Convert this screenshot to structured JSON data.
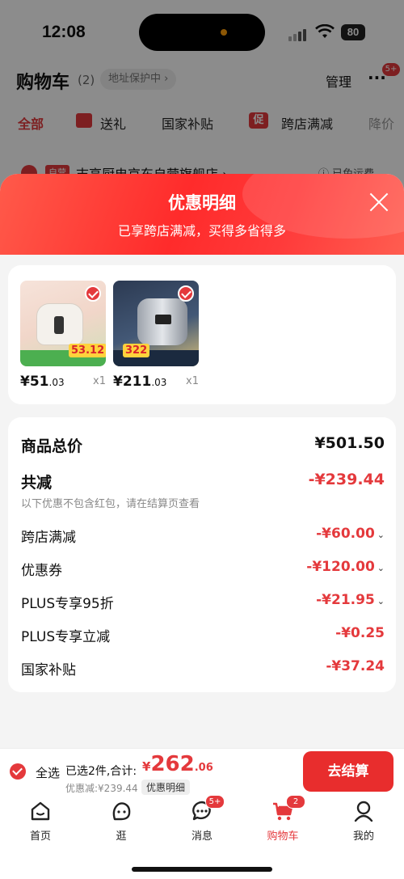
{
  "status_bar": {
    "time": "12:08",
    "battery": "80"
  },
  "background_cart": {
    "title": "购物车",
    "count": "(2)",
    "address_protection": "地址保护中 ›",
    "manage": "管理",
    "more_badge": "5+",
    "tabs": [
      "全部",
      "送礼",
      "国家补贴",
      "跨店满减",
      "降价"
    ],
    "cu_icon": "促",
    "store_tag": "自营",
    "store_name": "志高厨电京东自营旗舰店 ›",
    "shipping": "ⓘ 已免运费"
  },
  "sheet": {
    "title": "优惠明细",
    "subtitle": "已享跨店满减，买得多省得多",
    "products": [
      {
        "price_int": "¥51",
        "price_dec": ".03",
        "qty": "x1",
        "promo_price": "53.12"
      },
      {
        "price_int": "¥211",
        "price_dec": ".03",
        "qty": "x1",
        "promo_price": "322"
      }
    ],
    "summary": {
      "total_label": "商品总价",
      "total_value": "¥501.50",
      "reduce_label": "共减",
      "reduce_value": "-¥239.44",
      "note": "以下优惠不包含红包，请在结算页查看",
      "rows": [
        {
          "label": "跨店满减",
          "value": "-¥60.00",
          "chevron": "⌄"
        },
        {
          "label": "优惠券",
          "value": "-¥120.00",
          "chevron": "⌄"
        },
        {
          "label": "PLUS专享95折",
          "value": "-¥21.95",
          "chevron": "⌄"
        },
        {
          "label": "PLUS专享立减",
          "value": "-¥0.25",
          "chevron": ""
        },
        {
          "label": "国家补贴",
          "value": "-¥37.24",
          "chevron": ""
        }
      ]
    }
  },
  "bottom_bar": {
    "select_all": "全选",
    "selected_text": "已选2件,合计:",
    "total_yen": "¥",
    "total_int": "262",
    "total_dec": ".06",
    "discount_text": "优惠减:¥239.44",
    "discount_button": "优惠明细",
    "checkout": "去结算"
  },
  "nav": {
    "items": [
      {
        "label": "首页",
        "icon": "home-icon"
      },
      {
        "label": "逛",
        "icon": "face-icon"
      },
      {
        "label": "消息",
        "icon": "chat-icon",
        "badge": "5+"
      },
      {
        "label": "购物车",
        "icon": "cart-icon",
        "badge": "2"
      },
      {
        "label": "我的",
        "icon": "user-icon"
      }
    ]
  },
  "colors": {
    "accent": "#e4393c",
    "checkout": "#e82d2d"
  }
}
